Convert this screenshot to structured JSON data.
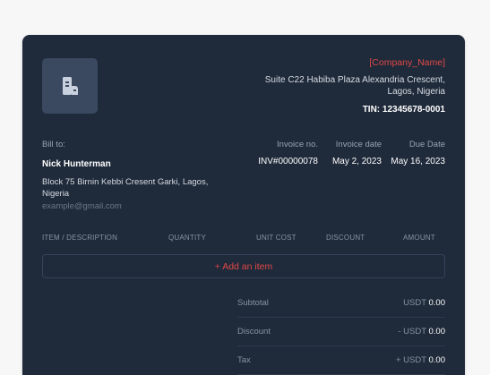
{
  "company": {
    "name": "[Company_Name]",
    "address_line1": "Suite C22 Habiba Plaza Alexandria Crescent,",
    "address_line2": "Lagos, Nigeria",
    "tin": "TIN: 12345678-0001",
    "logo_icon": "building-icon"
  },
  "bill_to": {
    "label": "Bill to:",
    "name": "Nick Hunterman",
    "address": "Block 75 Birnin Kebbi Cresent Garki, Lagos, Nigeria",
    "email_placeholder": "example@gmail.com"
  },
  "invoice_meta": {
    "invoice_no_label": "Invoice no.",
    "invoice_date_label": "Invoice date",
    "due_date_label": "Due Date",
    "invoice_no": "INV#00000078",
    "invoice_date": "May 2, 2023",
    "due_date": "May 16, 2023"
  },
  "items_table": {
    "columns": [
      "ITEM / DESCRIPTION",
      "QUANTITY",
      "UNIT COST",
      "DISCOUNT",
      "AMOUNT"
    ],
    "add_item_label": "+ Add an item"
  },
  "summary": {
    "subtotal_label": "Subtotal",
    "subtotal_prefix": "USDT",
    "subtotal_value": "0.00",
    "discount_label": "Discount",
    "discount_prefix": "- USDT",
    "discount_value": "0.00",
    "tax_label": "Tax",
    "tax_prefix": "+ USDT",
    "tax_value": "0.00"
  },
  "colors": {
    "card_bg": "#1f2a3a",
    "accent": "#e04848",
    "page_bg": "#f7f7f8"
  }
}
